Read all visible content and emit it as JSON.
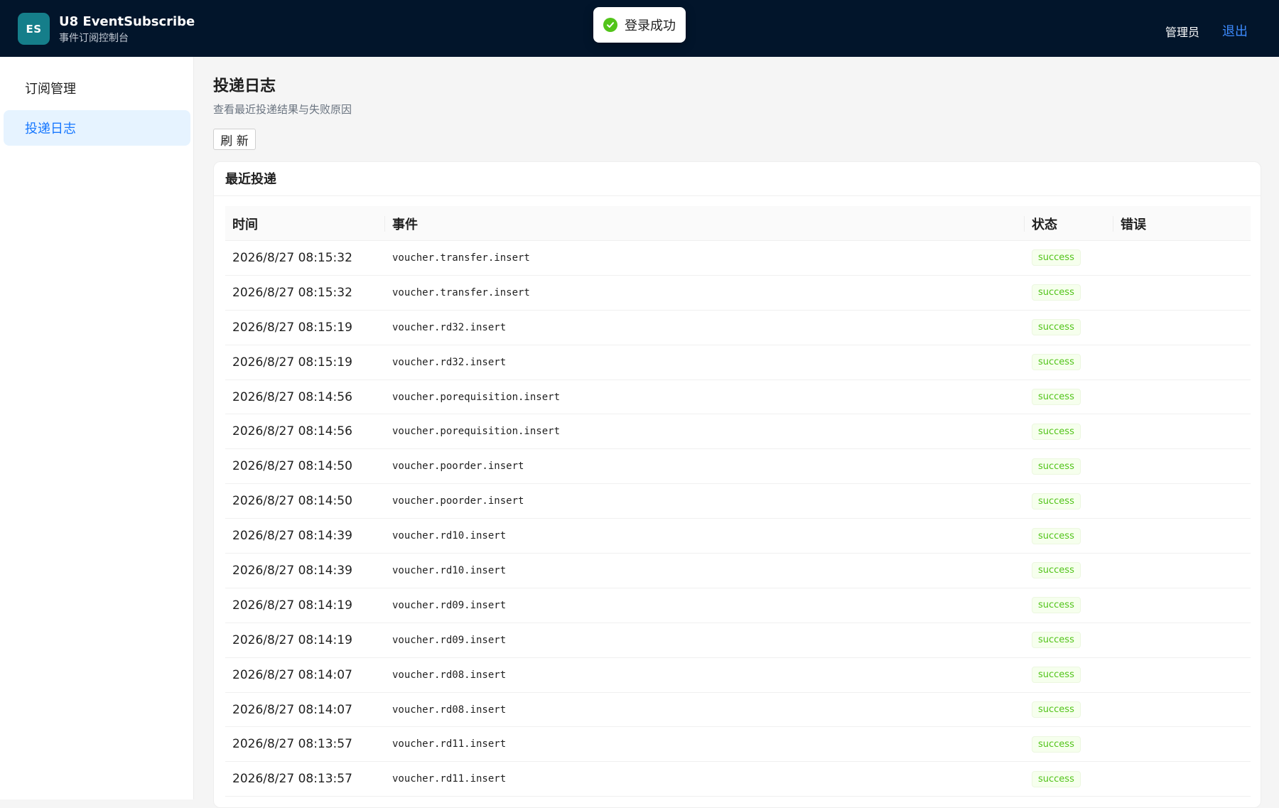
{
  "header": {
    "logo_text": "ES",
    "title": "U8 EventSubscribe",
    "subtitle": "事件订阅控制台",
    "user": "管理员",
    "logout": "退出"
  },
  "toast": {
    "text": "登录成功",
    "icon": "check-circle-icon",
    "color": "#52c41a"
  },
  "sidebar": {
    "items": [
      {
        "label": "订阅管理",
        "active": false
      },
      {
        "label": "投递日志",
        "active": true
      }
    ]
  },
  "main": {
    "title": "投递日志",
    "description": "查看最近投递结果与失败原因",
    "refresh_label": "刷 新",
    "card_title": "最近投递",
    "table": {
      "columns": [
        "时间",
        "事件",
        "状态",
        "错误"
      ],
      "rows": [
        {
          "time": "2026/8/27 08:15:32",
          "event": "voucher.transfer.insert",
          "status": "success",
          "error": ""
        },
        {
          "time": "2026/8/27 08:15:32",
          "event": "voucher.transfer.insert",
          "status": "success",
          "error": ""
        },
        {
          "time": "2026/8/27 08:15:19",
          "event": "voucher.rd32.insert",
          "status": "success",
          "error": ""
        },
        {
          "time": "2026/8/27 08:15:19",
          "event": "voucher.rd32.insert",
          "status": "success",
          "error": ""
        },
        {
          "time": "2026/8/27 08:14:56",
          "event": "voucher.porequisition.insert",
          "status": "success",
          "error": ""
        },
        {
          "time": "2026/8/27 08:14:56",
          "event": "voucher.porequisition.insert",
          "status": "success",
          "error": ""
        },
        {
          "time": "2026/8/27 08:14:50",
          "event": "voucher.poorder.insert",
          "status": "success",
          "error": ""
        },
        {
          "time": "2026/8/27 08:14:50",
          "event": "voucher.poorder.insert",
          "status": "success",
          "error": ""
        },
        {
          "time": "2026/8/27 08:14:39",
          "event": "voucher.rd10.insert",
          "status": "success",
          "error": ""
        },
        {
          "time": "2026/8/27 08:14:39",
          "event": "voucher.rd10.insert",
          "status": "success",
          "error": ""
        },
        {
          "time": "2026/8/27 08:14:19",
          "event": "voucher.rd09.insert",
          "status": "success",
          "error": ""
        },
        {
          "time": "2026/8/27 08:14:19",
          "event": "voucher.rd09.insert",
          "status": "success",
          "error": ""
        },
        {
          "time": "2026/8/27 08:14:07",
          "event": "voucher.rd08.insert",
          "status": "success",
          "error": ""
        },
        {
          "time": "2026/8/27 08:14:07",
          "event": "voucher.rd08.insert",
          "status": "success",
          "error": ""
        },
        {
          "time": "2026/8/27 08:13:57",
          "event": "voucher.rd11.insert",
          "status": "success",
          "error": ""
        },
        {
          "time": "2026/8/27 08:13:57",
          "event": "voucher.rd11.insert",
          "status": "success",
          "error": ""
        }
      ]
    }
  },
  "colors": {
    "header_bg": "#02152b",
    "logo_bg": "#157e8a",
    "accent": "#1677ff",
    "success": "#52c41a"
  }
}
